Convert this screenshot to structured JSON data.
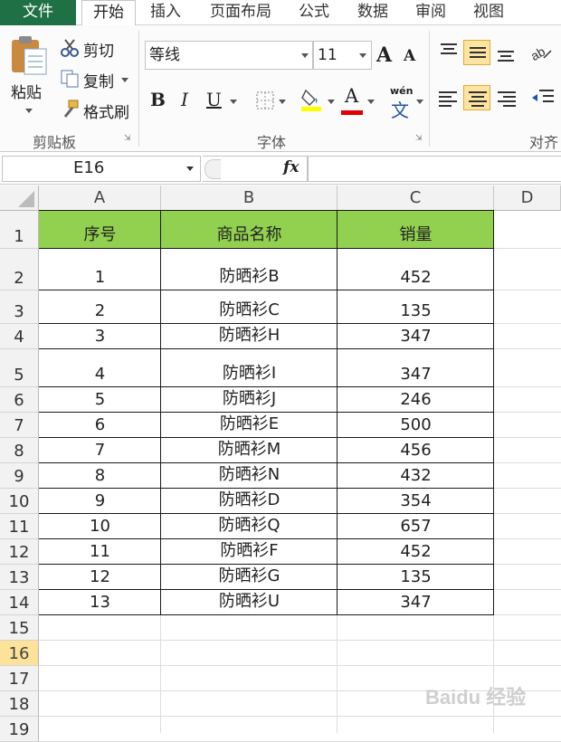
{
  "ribbon_tabs": {
    "file": "文件",
    "home": "开始",
    "insert": "插入",
    "layout": "页面布局",
    "formulas": "公式",
    "data": "数据",
    "review": "审阅",
    "view": "视图"
  },
  "clipboard": {
    "paste": "粘贴",
    "cut": "剪切",
    "copy": "复制",
    "format_painter": "格式刷",
    "group_label": "剪贴板"
  },
  "font": {
    "name": "等线",
    "size": "11",
    "bold": "B",
    "italic": "I",
    "underline": "U",
    "font_color_glyph": "A",
    "phonetic_glyph": "wén",
    "phonetic_char": "文",
    "grow_glyph": "A",
    "shrink_glyph": "A",
    "group_label": "字体"
  },
  "alignment": {
    "group_label": "对齐"
  },
  "formula_bar": {
    "name_box": "E16",
    "fx": "fx",
    "value": ""
  },
  "columns": [
    "A",
    "B",
    "C",
    "D"
  ],
  "rows": [
    "1",
    "2",
    "3",
    "4",
    "5",
    "6",
    "7",
    "8",
    "9",
    "10",
    "11",
    "12",
    "13",
    "14",
    "15",
    "16",
    "17",
    "18",
    "19"
  ],
  "active_row": "16",
  "table": {
    "headers": [
      "序号",
      "商品名称",
      "销量"
    ],
    "records": [
      [
        "1",
        "防晒衫B",
        "452"
      ],
      [
        "2",
        "防晒衫C",
        "135"
      ],
      [
        "3",
        "防晒衫H",
        "347"
      ],
      [
        "4",
        "防晒衫I",
        "347"
      ],
      [
        "5",
        "防晒衫J",
        "246"
      ],
      [
        "6",
        "防晒衫E",
        "500"
      ],
      [
        "7",
        "防晒衫M",
        "456"
      ],
      [
        "8",
        "防晒衫N",
        "432"
      ],
      [
        "9",
        "防晒衫D",
        "354"
      ],
      [
        "10",
        "防晒衫Q",
        "657"
      ],
      [
        "11",
        "防晒衫F",
        "452"
      ],
      [
        "12",
        "防晒衫G",
        "135"
      ],
      [
        "13",
        "防晒衫U",
        "347"
      ]
    ]
  },
  "colors": {
    "header_fill": "#92d050",
    "excel_green": "#1f7145",
    "active_row": "#fde39a"
  },
  "watermark": "Baidu 经验"
}
